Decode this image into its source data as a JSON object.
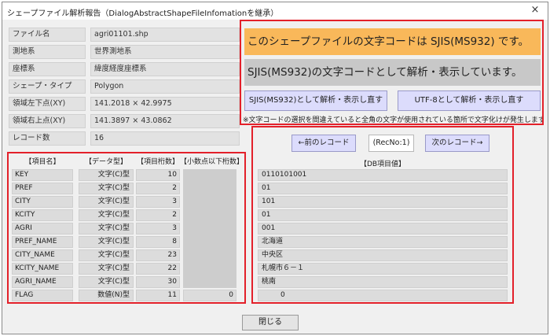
{
  "window": {
    "title": "シェープファイル解析報告（DialogAbstractShapeFileInfomationを継承）",
    "close_glyph": "×"
  },
  "info": [
    {
      "label": "ファイル名",
      "value": "agri01101.shp"
    },
    {
      "label": "測地系",
      "value": "世界測地系"
    },
    {
      "label": "座標系",
      "value": "緯度経度座標系"
    },
    {
      "label": "シェープ・タイプ",
      "value": "Polygon"
    },
    {
      "label": "領域左下点(XY)",
      "value": "141.2018 × 42.9975"
    },
    {
      "label": "領域右上点(XY)",
      "value": "141.3897 × 43.0862"
    },
    {
      "label": "レコード数",
      "value": "16"
    }
  ],
  "encoding": {
    "banner": "このシェープファイルの文字コードは SJIS(MS932) です。",
    "status": "SJIS(MS932)の文字コードとして解析・表示しています。",
    "btn_sjis": "SJIS(MS932)として解析・表示し直す",
    "btn_utf8": "UTF-8として解析・表示し直す",
    "note": "※文字コードの選択を間違えていると全角の文字が使用されている箇所で文字化けが発生します。"
  },
  "fields": {
    "headers": {
      "name": "【項目名】",
      "type": "【データ型】",
      "length": "【項目桁数】",
      "decimals": "【小数点以下桁数】"
    },
    "rows": [
      {
        "name": "KEY",
        "type": "文字(C)型",
        "length": "10",
        "decimals": ""
      },
      {
        "name": "PREF",
        "type": "文字(C)型",
        "length": "2",
        "decimals": ""
      },
      {
        "name": "CITY",
        "type": "文字(C)型",
        "length": "3",
        "decimals": ""
      },
      {
        "name": "KCITY",
        "type": "文字(C)型",
        "length": "2",
        "decimals": ""
      },
      {
        "name": "AGRI",
        "type": "文字(C)型",
        "length": "3",
        "decimals": ""
      },
      {
        "name": "PREF_NAME",
        "type": "文字(C)型",
        "length": "8",
        "decimals": ""
      },
      {
        "name": "CITY_NAME",
        "type": "文字(C)型",
        "length": "23",
        "decimals": ""
      },
      {
        "name": "KCITY_NAME",
        "type": "文字(C)型",
        "length": "22",
        "decimals": ""
      },
      {
        "name": "AGRI_NAME",
        "type": "文字(C)型",
        "length": "30",
        "decimals": ""
      },
      {
        "name": "FLAG",
        "type": "数値(N)型",
        "length": "11",
        "decimals": "0"
      }
    ]
  },
  "record": {
    "prev_label": "←前のレコード",
    "recno": "(RecNo:1)",
    "next_label": "次のレコード→",
    "header": "【DB項目値】",
    "values": [
      "0110101001",
      "01",
      "101",
      "01",
      "001",
      "北海道",
      "中央区",
      "札幌市６－１",
      "桃南",
      "0"
    ]
  },
  "footer": {
    "close_label": "閉じる"
  }
}
